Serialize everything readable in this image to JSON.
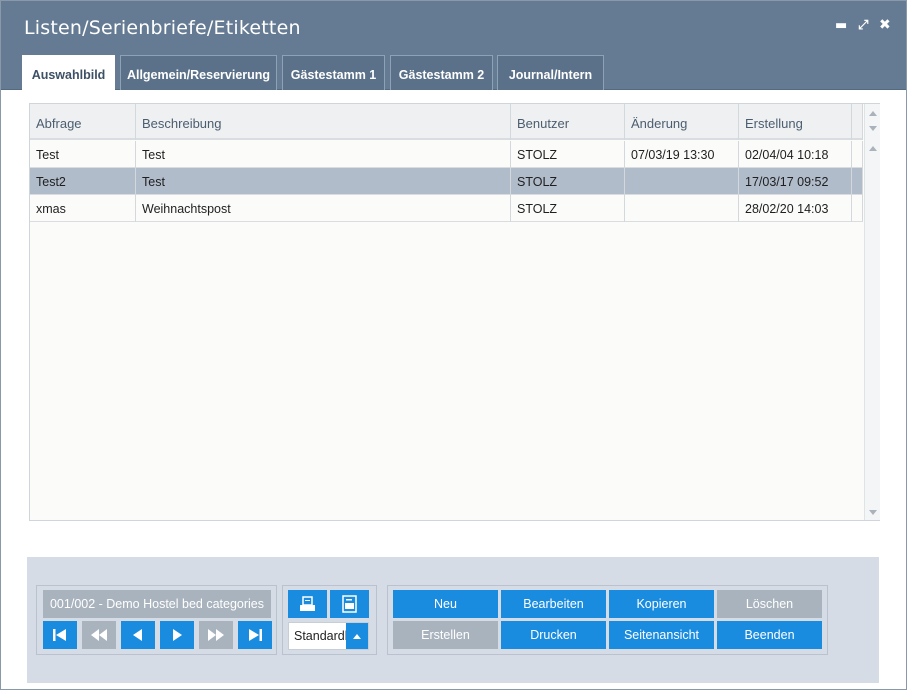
{
  "window": {
    "title": "Listen/Serienbriefe/Etiketten",
    "controls": {
      "minimize": "▬",
      "maximize": "⤢",
      "close": "✖"
    }
  },
  "tabs": [
    {
      "label": "Auswahlbild",
      "active": true
    },
    {
      "label": "Allgemein/Reservierung",
      "active": false
    },
    {
      "label": "Gästestamm 1",
      "active": false
    },
    {
      "label": "Gästestamm 2",
      "active": false
    },
    {
      "label": "Journal/Intern",
      "active": false
    }
  ],
  "table": {
    "columns": [
      "Abfrage",
      "Beschreibung",
      "Benutzer",
      "Änderung",
      "Erstellung"
    ],
    "rows": [
      {
        "abfrage": "Test",
        "beschreibung": "Test",
        "benutzer": "STOLZ",
        "aenderung": "07/03/19 13:30",
        "erstellung": "02/04/04 10:18",
        "selected": false
      },
      {
        "abfrage": "Test2",
        "beschreibung": "Test",
        "benutzer": "STOLZ",
        "aenderung": "",
        "erstellung": "17/03/17 09:52",
        "selected": true
      },
      {
        "abfrage": "xmas",
        "beschreibung": "Weihnachtspost",
        "benutzer": "STOLZ",
        "aenderung": "",
        "erstellung": "28/02/20 14:03",
        "selected": false
      }
    ]
  },
  "navigator": {
    "record_info": "001/002 - Demo Hostel bed categories",
    "buttons": [
      {
        "icon": "first-record-icon",
        "enabled": true
      },
      {
        "icon": "fast-back-icon",
        "enabled": false
      },
      {
        "icon": "previous-icon",
        "enabled": true
      },
      {
        "icon": "next-icon",
        "enabled": true
      },
      {
        "icon": "fast-forward-icon",
        "enabled": false
      },
      {
        "icon": "last-record-icon",
        "enabled": true
      }
    ]
  },
  "output": {
    "icons": [
      "printer-icon",
      "pdf-icon"
    ],
    "combo_value": "Standardliste"
  },
  "actions": {
    "row1": [
      {
        "label": "Neu",
        "enabled": true
      },
      {
        "label": "Bearbeiten",
        "enabled": true
      },
      {
        "label": "Kopieren",
        "enabled": true
      },
      {
        "label": "Löschen",
        "enabled": false
      }
    ],
    "row2": [
      {
        "label": "Erstellen",
        "enabled": false
      },
      {
        "label": "Drucken",
        "enabled": true
      },
      {
        "label": "Seitenansicht",
        "enabled": true
      },
      {
        "label": "Beenden",
        "enabled": true
      }
    ]
  },
  "colors": {
    "titlebar": "#647b93",
    "accent": "#1a8ce0",
    "disabled": "#a9b3be",
    "selected_row": "#b1bccb",
    "panel": "#d6dce6"
  }
}
